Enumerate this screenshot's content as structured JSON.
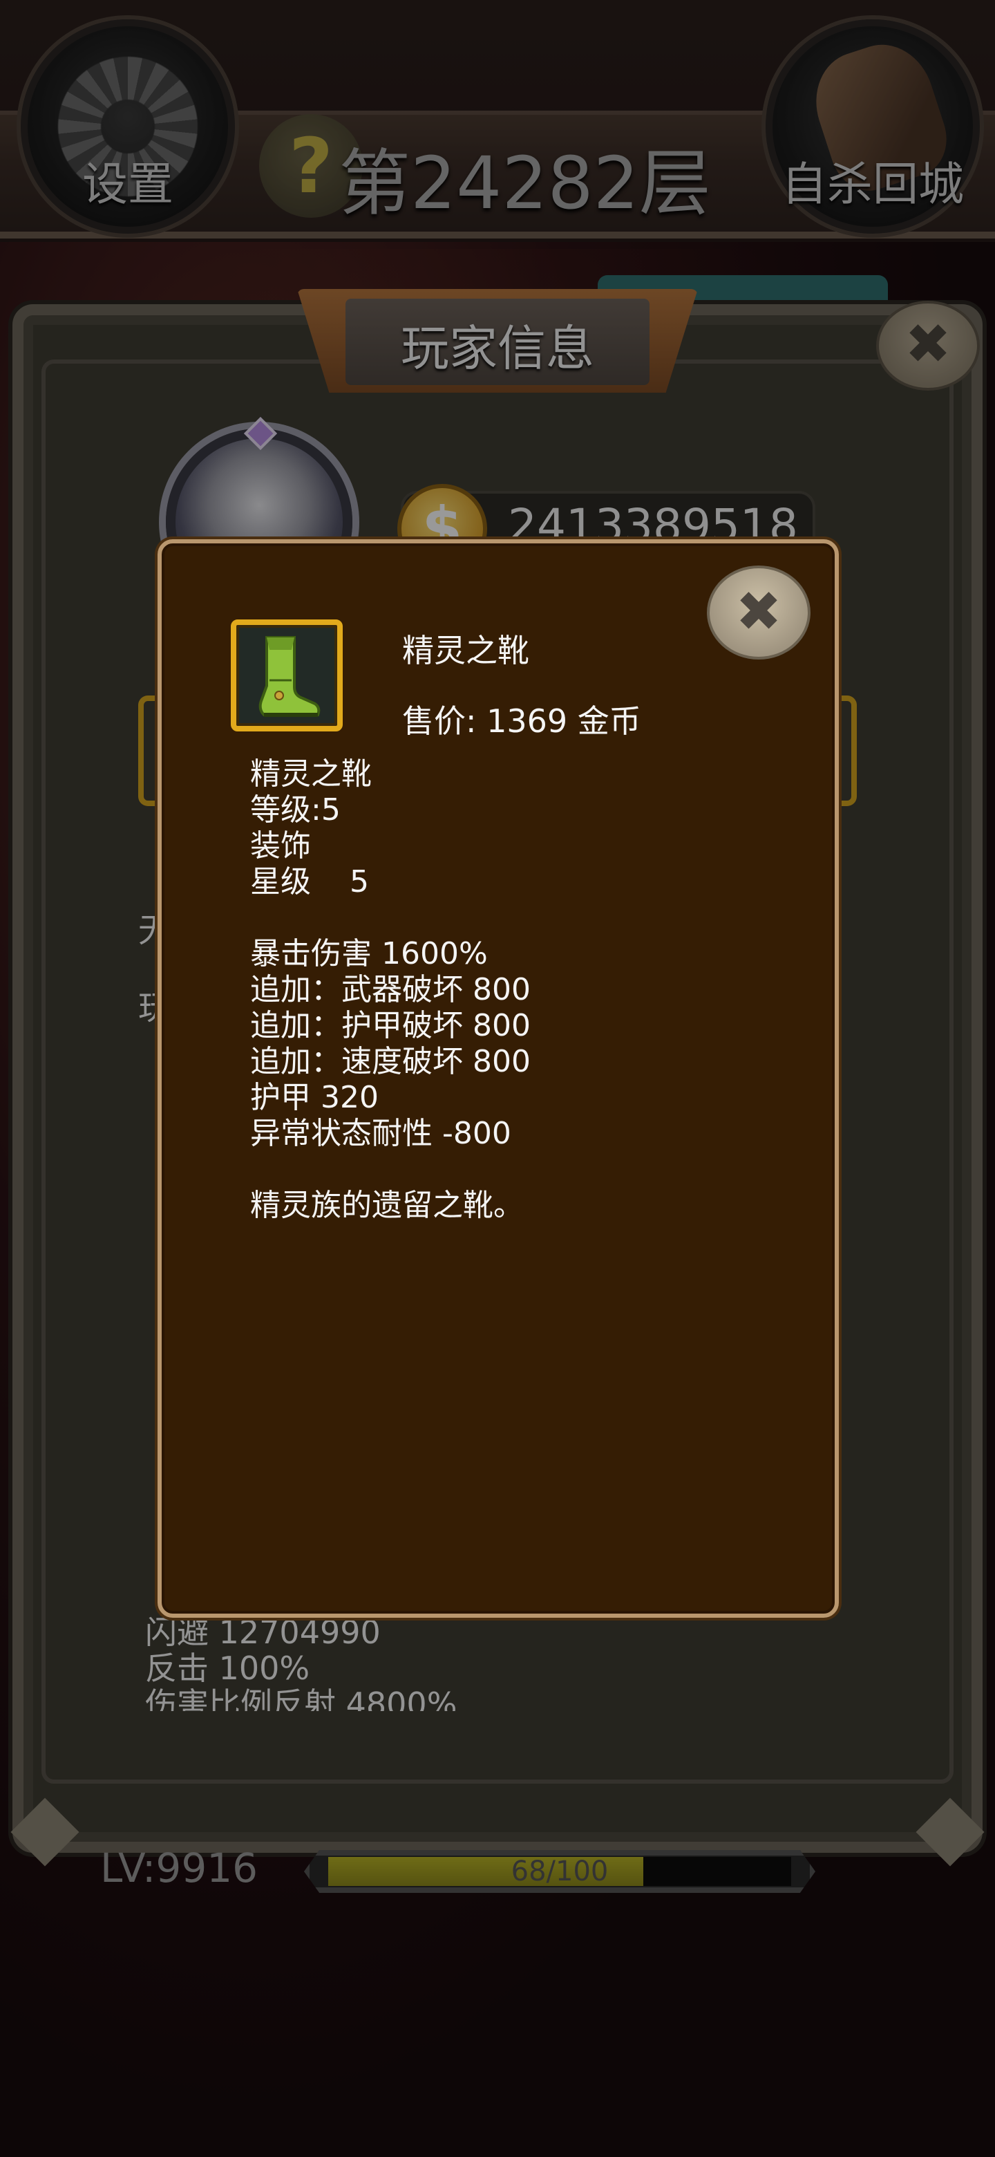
{
  "hud": {
    "settings_label": "设置",
    "floor_title": "第24282层",
    "return_label": "自杀回城"
  },
  "panel": {
    "title": "玩家信息",
    "gold": "2413389518",
    "partial_chars": [
      "无",
      "玩"
    ],
    "stats_visible": [
      "闪避 12704990",
      "反击 100%",
      "伤害比例反射 4800%"
    ],
    "level": "LV:9916",
    "xp_text": "68/100",
    "xp_fraction": 0.68
  },
  "item": {
    "name": "精灵之靴",
    "price_line": "售价: 1369 金币",
    "details": [
      "精灵之靴",
      "等级:5",
      "装饰",
      "星级    5",
      "",
      "暴击伤害 1600%",
      "追加：武器破坏 800",
      "追加：护甲破坏 800",
      "追加：速度破坏 800",
      "护甲 320",
      "异常状态耐性 -800",
      "",
      "精灵族的遗留之靴。"
    ]
  },
  "icons": {
    "close": "close-icon",
    "coin": "coin-icon",
    "help": "help-icon",
    "gear": "gear-icon",
    "fist": "fist-icon",
    "boot": "boot-icon"
  },
  "colors": {
    "modal_bg": "#351d04",
    "modal_border": "#b9976e",
    "item_frame": "#e2aa1c",
    "xp_fill": "#b9b426"
  }
}
